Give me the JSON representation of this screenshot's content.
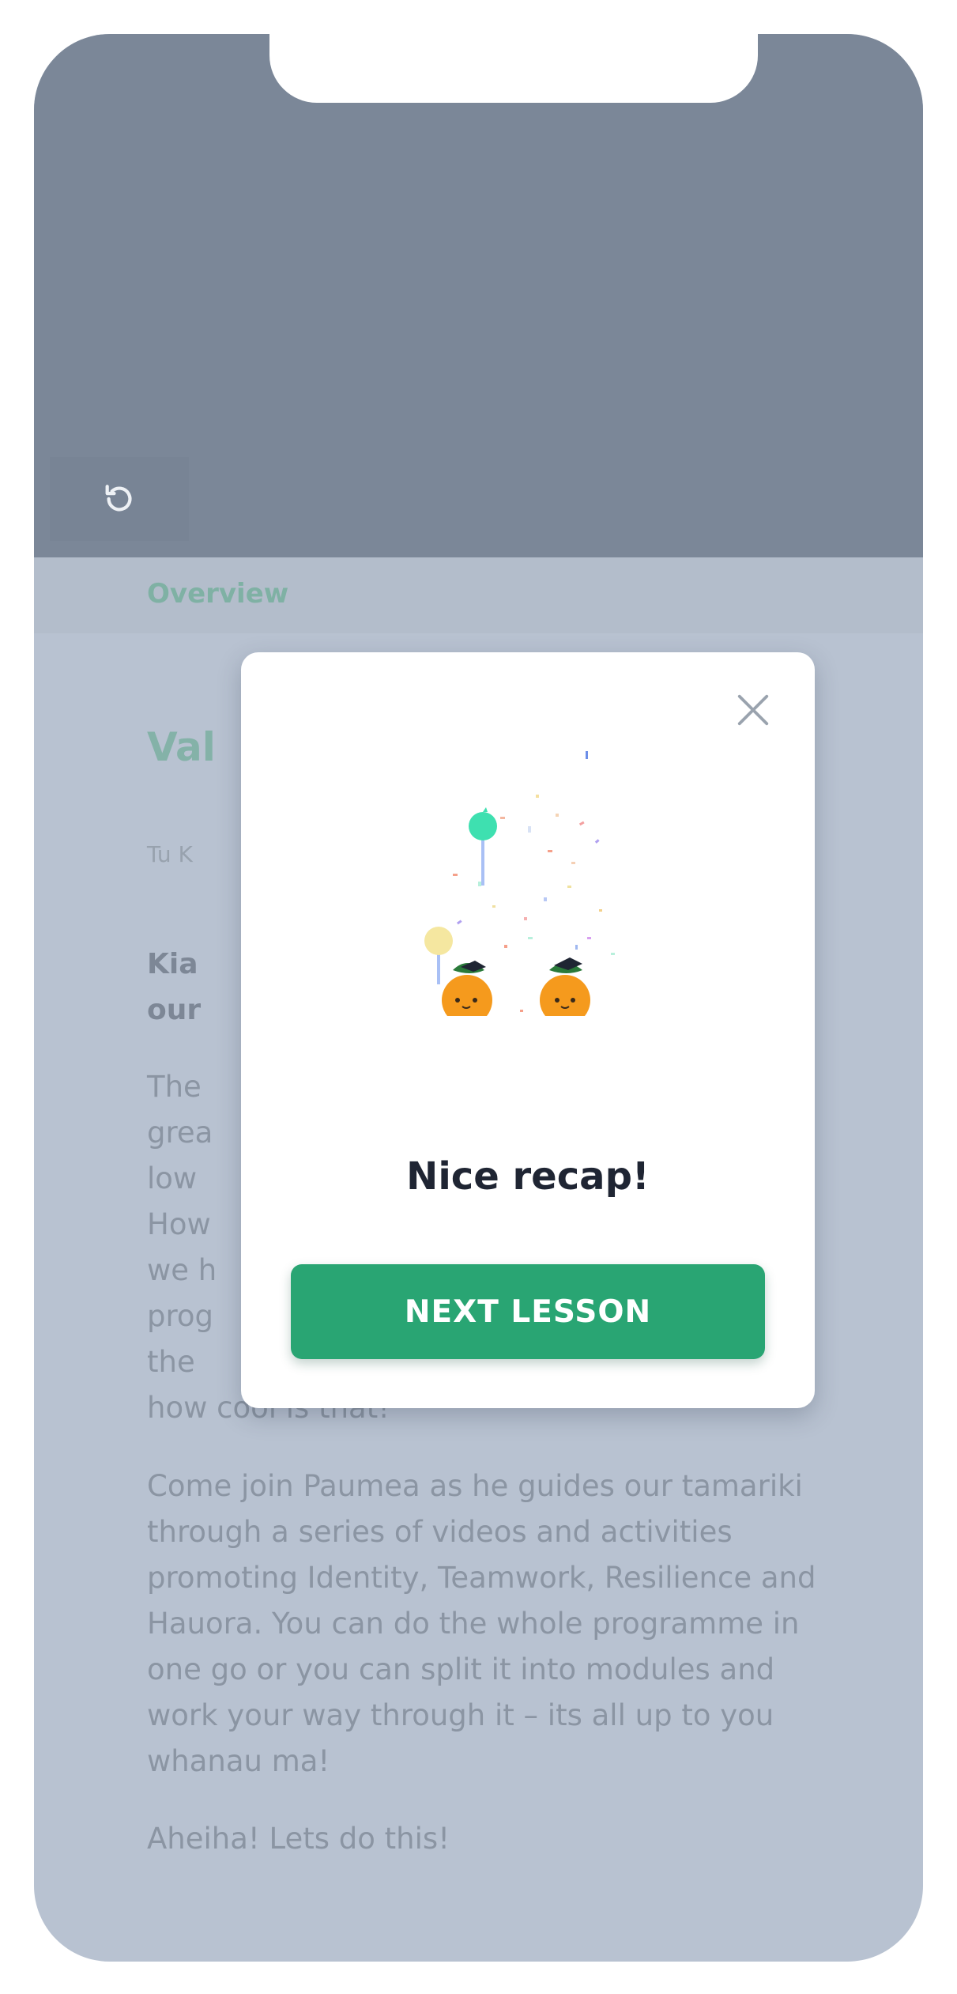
{
  "header": {
    "tab_overview": "Overview"
  },
  "lesson": {
    "title": "Val",
    "meta": "Tu K",
    "greeting": "Kia                                         o”\nour",
    "para1_left": "The\ngrea\nlow\nHow\nwe h\nprog\nthe\nhow cool is that!",
    "para2": "Come join Paumea as he guides our tamariki through a series of videos and activities promoting Identity, Teamwork, Resilience and Hauora. You can do the whole programme in one go or you can split it into modules and work your way through it – its all up to you whanau ma!",
    "para3": "Aheiha! Lets do this!"
  },
  "modal": {
    "title": "Nice recap!",
    "next_label": "NEXT LESSON"
  },
  "colors": {
    "accent": "#29a573",
    "overlay": "#b8c2d1",
    "video_bg": "#7b8798"
  },
  "icons": [
    "replay-icon",
    "close-icon",
    "celebration-illustration"
  ]
}
